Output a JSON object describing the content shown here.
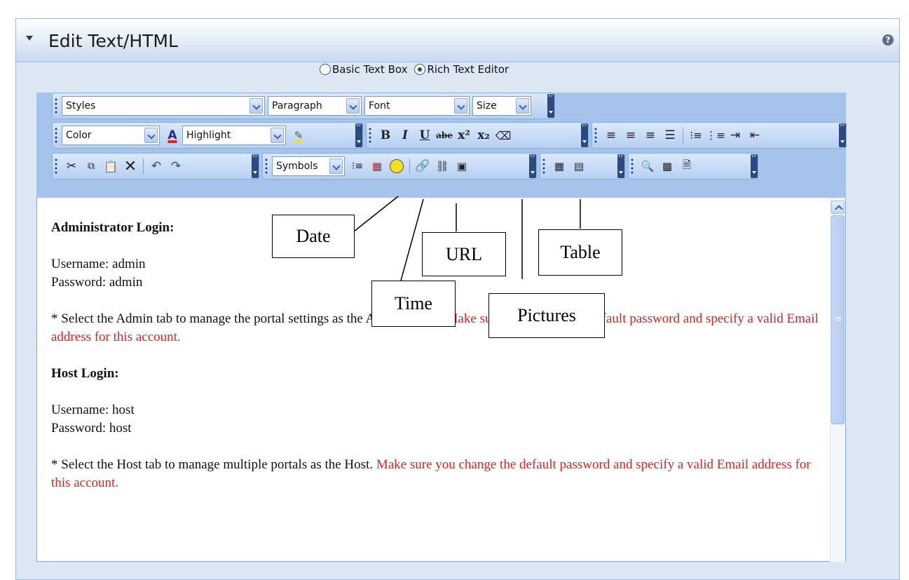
{
  "panel": {
    "title": "Edit Text/HTML",
    "help_icon": "?"
  },
  "mode_options": [
    {
      "label": "Basic Text Box",
      "selected": false
    },
    {
      "label": "Rich Text Editor",
      "selected": true
    }
  ],
  "toolbar": {
    "row1": {
      "styles": "Styles",
      "paragraph": "Paragraph",
      "font": "Font",
      "size": "Size"
    },
    "row2": {
      "color": "Color",
      "highlight": "Highlight",
      "bold": "B",
      "italic": "I",
      "underline": "U",
      "strike": "abe"
    },
    "row3": {
      "symbols": "Symbols"
    }
  },
  "editor": {
    "admin_heading": "Administrator Login:",
    "admin_username": "Username: admin",
    "admin_password": "Password: admin",
    "admin_note_black": "* Select the Admin tab to manage the portal settings as the Administrator.",
    "admin_note_red": "Make sure you change the default password and specify a valid Email address for this account.",
    "host_heading": "Host Login:",
    "host_username": "Username: host",
    "host_password": "Password: host",
    "host_note_black": "* Select the Host tab to manage multiple portals as the Host.",
    "host_note_red": "Make sure you change the default password and specify a valid Email address for this account."
  },
  "callouts": {
    "date": "Date",
    "time": "Time",
    "url": "URL",
    "pictures": "Pictures",
    "table": "Table"
  },
  "colors": {
    "panel_bg": "#dde7f4",
    "toolbar_bg": "#a6c3ec",
    "warning_text": "#e02020"
  }
}
